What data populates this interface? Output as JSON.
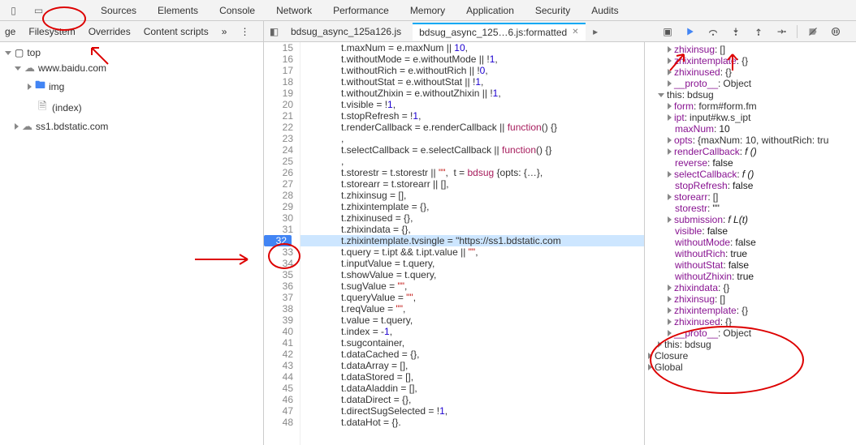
{
  "top_tabs": {
    "items": [
      "Sources",
      "Elements",
      "Console",
      "Network",
      "Performance",
      "Memory",
      "Application",
      "Security",
      "Audits"
    ],
    "active": 0
  },
  "sec_bar": {
    "left": [
      "ge",
      "Filesystem",
      "Overrides",
      "Content scripts",
      "»"
    ],
    "tabs": [
      {
        "label": "bdsug_async_125a126.js",
        "active": false
      },
      {
        "label": "bdsug_async_125…6.js:formatted",
        "active": true
      }
    ]
  },
  "tree": {
    "top": "top",
    "domain1": "www.baidu.com",
    "folder1": "img",
    "file1": "(index)",
    "domain2": "ss1.bdstatic.com"
  },
  "code": {
    "start": 15,
    "breakpoint": 32,
    "lines": [
      "t.maxNum = e.maxNum || 10,",
      "t.withoutMode = e.withoutMode || !1,",
      "t.withoutRich = e.withoutRich || !0,",
      "t.withoutStat = e.withoutStat || !1,",
      "t.withoutZhixin = e.withoutZhixin || !1,",
      "t.visible = !1,",
      "t.stopRefresh = !1,",
      "t.renderCallback = e.renderCallback || function() {}",
      ",",
      "t.selectCallback = e.selectCallback || function() {}",
      ",",
      "t.storestr = t.storestr || \"\",  t = bdsug {opts: {…},",
      "t.storearr = t.storearr || [],",
      "t.zhixinsug = [],",
      "t.zhixintemplate = {},",
      "t.zhixinused = {},",
      "t.zhixindata = {},",
      "t.zhixintemplate.tvsingle = \"https://ss1.bdstatic.com",
      "t.query = t.ipt && t.ipt.value || \"\",",
      "t.inputValue = t.query,",
      "t.showValue = t.query,",
      "t.sugValue = \"\",",
      "t.queryValue = \"\",",
      "t.reqValue = \"\",",
      "t.value = t.query,",
      "t.index = -1,",
      "t.sugcontainer,",
      "t.dataCached = {},",
      "t.dataArray = [],",
      "t.dataStored = [],",
      "t.dataAladdin = [],",
      "t.dataDirect = {},",
      "t.directSugSelected = !1,",
      "t.dataHot = {}."
    ]
  },
  "scope": {
    "rows": [
      {
        "ind": 2,
        "tri": "r",
        "key": "zhixinsug",
        "val": "[]"
      },
      {
        "ind": 2,
        "tri": "r",
        "key": "zhixintemplate",
        "val": "{}"
      },
      {
        "ind": 2,
        "tri": "r",
        "key": "zhixinused",
        "val": "{}"
      },
      {
        "ind": 2,
        "tri": "r",
        "key": "__proto__",
        "val": "Object"
      },
      {
        "ind": 1,
        "tri": "d",
        "key": "this",
        "val": "bdsug",
        "hdr": true
      },
      {
        "ind": 2,
        "tri": "r",
        "key": "form",
        "val": "form#form.fm"
      },
      {
        "ind": 2,
        "tri": "r",
        "key": "ipt",
        "val": "input#kw.s_ipt"
      },
      {
        "ind": 2,
        "tri": "",
        "key": "maxNum",
        "val": "10",
        "num": true
      },
      {
        "ind": 2,
        "tri": "r",
        "key": "opts",
        "val": "{maxNum: 10, withoutRich: tru"
      },
      {
        "ind": 2,
        "tri": "r",
        "key": "renderCallback",
        "val": "f ()",
        "fn": true
      },
      {
        "ind": 2,
        "tri": "",
        "key": "reverse",
        "val": "false",
        "num": true
      },
      {
        "ind": 2,
        "tri": "r",
        "key": "selectCallback",
        "val": "f ()",
        "fn": true
      },
      {
        "ind": 2,
        "tri": "",
        "key": "stopRefresh",
        "val": "false",
        "num": true
      },
      {
        "ind": 2,
        "tri": "r",
        "key": "storearr",
        "val": "[]"
      },
      {
        "ind": 2,
        "tri": "",
        "key": "storestr",
        "val": "\"\"",
        "str": true
      },
      {
        "ind": 2,
        "tri": "r",
        "key": "submission",
        "val": "f L(t)",
        "fn": true
      },
      {
        "ind": 2,
        "tri": "",
        "key": "visible",
        "val": "false",
        "num": true
      },
      {
        "ind": 2,
        "tri": "",
        "key": "withoutMode",
        "val": "false",
        "num": true
      },
      {
        "ind": 2,
        "tri": "",
        "key": "withoutRich",
        "val": "true",
        "num": true
      },
      {
        "ind": 2,
        "tri": "",
        "key": "withoutStat",
        "val": "false",
        "num": true
      },
      {
        "ind": 2,
        "tri": "",
        "key": "withoutZhixin",
        "val": "true",
        "num": true
      },
      {
        "ind": 2,
        "tri": "r",
        "key": "zhixindata",
        "val": "{}"
      },
      {
        "ind": 2,
        "tri": "r",
        "key": "zhixinsug",
        "val": "[]"
      },
      {
        "ind": 2,
        "tri": "r",
        "key": "zhixintemplate",
        "val": "{}"
      },
      {
        "ind": 2,
        "tri": "r",
        "key": "zhixinused",
        "val": "{}"
      },
      {
        "ind": 2,
        "tri": "r",
        "key": "__proto__",
        "val": "Object"
      },
      {
        "ind": 1,
        "tri": "r",
        "key": "this",
        "val": "bdsug",
        "hdr": true
      },
      {
        "ind": 0,
        "tri": "r",
        "key": "Closure",
        "val": "",
        "hdr": true
      },
      {
        "ind": 0,
        "tri": "r",
        "key": "Global",
        "val": "",
        "hdr": true
      }
    ]
  }
}
